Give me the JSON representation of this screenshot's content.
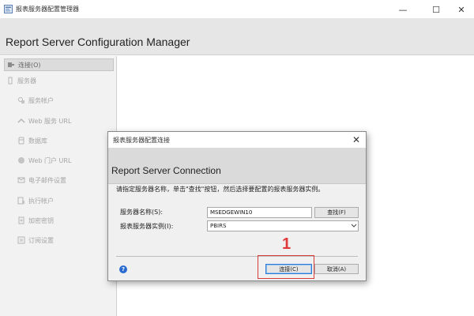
{
  "window": {
    "title": "报表服务器配置管理器",
    "controls": {
      "minimize": "—",
      "maximize": "☐",
      "close": "✕"
    }
  },
  "app": {
    "heading": "Report Server Configuration Manager"
  },
  "sidebar": {
    "items": [
      {
        "label": "连接(O)",
        "icon": "connect-icon"
      },
      {
        "label": "服务器",
        "icon": "server-icon"
      },
      {
        "label": "服务帐户",
        "icon": "service-account-icon"
      },
      {
        "label": "Web 服务 URL",
        "icon": "web-service-icon"
      },
      {
        "label": "数据库",
        "icon": "database-icon"
      },
      {
        "label": "Web 门户 URL",
        "icon": "web-portal-icon"
      },
      {
        "label": "电子邮件设置",
        "icon": "email-icon"
      },
      {
        "label": "执行帐户",
        "icon": "execution-account-icon"
      },
      {
        "label": "加密密钥",
        "icon": "encryption-key-icon"
      },
      {
        "label": "订阅设置",
        "icon": "subscription-icon"
      }
    ]
  },
  "dialog": {
    "title": "报表服务器配置连接",
    "close": "✕",
    "heading": "Report Server Connection",
    "instruction": "请指定服务器名称，单击\"查找\"按钮，然后选择要配置的报表服务器实例。",
    "server_label": "服务器名称(S):",
    "server_value": "MSEDGEWIN10",
    "find_label": "查找(F)",
    "instance_label": "报表服务器实例(I):",
    "instance_value": "PBIRS",
    "connect_label": "连接(C)",
    "cancel_label": "取消(A)",
    "help": "?"
  },
  "annotation": {
    "number": "1",
    "color": "#e03a3a"
  },
  "colors": {
    "header_bg": "#e6e6e6",
    "sidebar_bg": "#f2f2f2",
    "focus_border": "#2f7bd3",
    "help_icon": "#2a6bd1"
  }
}
